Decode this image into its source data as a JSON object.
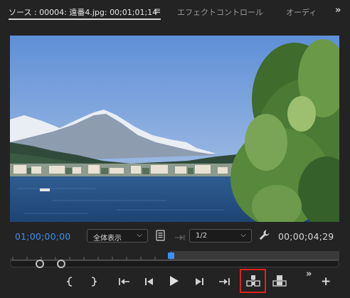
{
  "tabs": {
    "source_label": "ソース : 00004: 遠番4.jpg: 00;01;01;14",
    "menu_glyph": "≡",
    "effect_controls_label": "エフェクトコントロール",
    "audio_label": "オーディ",
    "more_glyph": "»"
  },
  "timecode": {
    "current": "01;00;00;00",
    "duration": "00;00;04;29"
  },
  "zoom_dropdown": {
    "selected": "全体表示",
    "chevron": "⌵"
  },
  "resolution_dropdown": {
    "selected": "1/2",
    "chevron": "⌵"
  },
  "playhead_position": 0.0,
  "icons": [
    "export-frame-icon",
    "step-forward-disabled-icon",
    "wrench-icon",
    "mark-in-icon",
    "mark-out-icon",
    "go-to-in-icon",
    "step-back-icon",
    "play-icon",
    "step-forward-icon",
    "go-to-out-icon",
    "insert-icon",
    "overwrite-icon",
    "more-controls-icon",
    "add-button-icon"
  ],
  "controls": {
    "more_glyph": "»",
    "add_glyph": "+"
  },
  "colors": {
    "timecode_blue": "#3d8ff0",
    "highlight_red": "#e0201e",
    "background": "#232323"
  }
}
